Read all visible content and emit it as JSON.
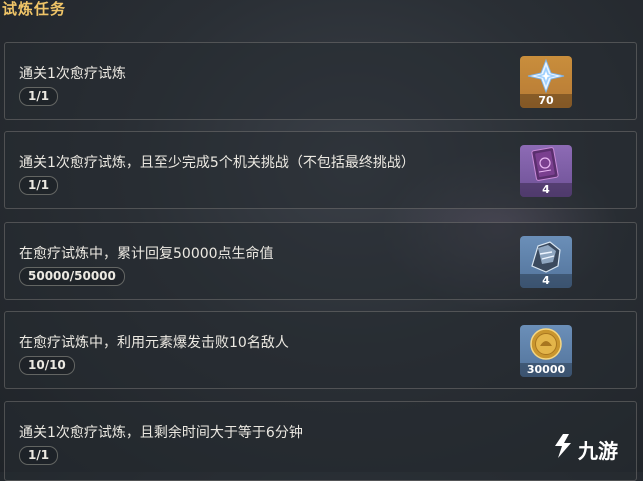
{
  "header": {
    "title": "试炼任务"
  },
  "tasks": [
    {
      "label": "通关1次愈疗试炼",
      "progress": "1/1",
      "reward": {
        "icon": "primogem-icon",
        "count": "70",
        "color": "#c98e3c"
      }
    },
    {
      "label": "通关1次愈疗试炼，且至少完成5个机关挑战（不包括最终挑战）",
      "progress": "1/1",
      "reward": {
        "icon": "heros-wit-book-icon",
        "count": "4",
        "color": "#8d6bb5"
      }
    },
    {
      "label": "在愈疗试炼中，累计回复50000点生命值",
      "progress": "50000/50000",
      "reward": {
        "icon": "enhancement-ore-icon",
        "count": "4",
        "color": "#6b8fb8"
      }
    },
    {
      "label": "在愈疗试炼中，利用元素爆发击败10名敌人",
      "progress": "10/10",
      "reward": {
        "icon": "mora-coin-icon",
        "count": "30000",
        "color": "#6b8fb8"
      }
    },
    {
      "label": "通关1次愈疗试炼，且剩余时间大于等于6分钟",
      "progress": "1/1"
    }
  ],
  "watermark": {
    "text": "九游"
  }
}
